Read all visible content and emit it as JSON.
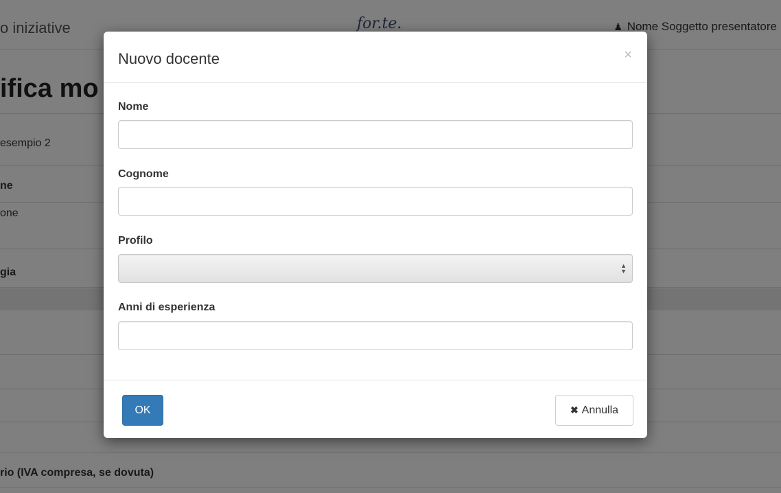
{
  "background": {
    "topbar_title": "o iniziative",
    "logo_text": "for.te.",
    "user_icon": "user-icon",
    "user_name": "Nome Soggetto presentatore",
    "page_heading": "ifica mo",
    "rows": [
      {
        "text": " esempio 2"
      },
      {
        "text": "ne"
      },
      {
        "text": "one"
      },
      {
        "text": "gia"
      },
      {
        "text": ""
      },
      {
        "text": ""
      },
      {
        "text": ""
      },
      {
        "text": "rio (IVA compresa, se dovuta)"
      }
    ]
  },
  "modal": {
    "title": "Nuovo docente",
    "close_icon": "close-icon",
    "close_glyph": "×",
    "fields": {
      "nome": {
        "label": "Nome",
        "value": ""
      },
      "cognome": {
        "label": "Cognome",
        "value": ""
      },
      "profilo": {
        "label": "Profilo",
        "selected": ""
      },
      "anni": {
        "label": "Anni di esperienza",
        "value": ""
      }
    },
    "ok_label": "OK",
    "cancel_icon": "x-icon",
    "cancel_label": "Annulla"
  }
}
